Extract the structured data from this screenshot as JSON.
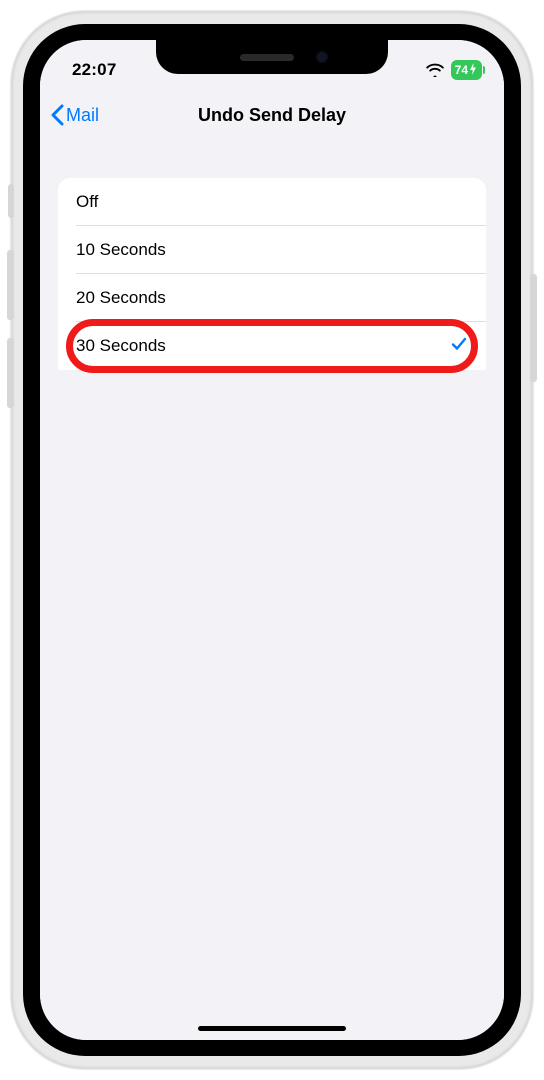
{
  "status": {
    "time": "22:07",
    "battery_text": "74"
  },
  "nav": {
    "back_label": "Mail",
    "title": "Undo Send Delay"
  },
  "options": [
    {
      "label": "Off",
      "selected": false
    },
    {
      "label": "10 Seconds",
      "selected": false
    },
    {
      "label": "20 Seconds",
      "selected": false
    },
    {
      "label": "30 Seconds",
      "selected": true
    }
  ],
  "highlight_index": 3
}
